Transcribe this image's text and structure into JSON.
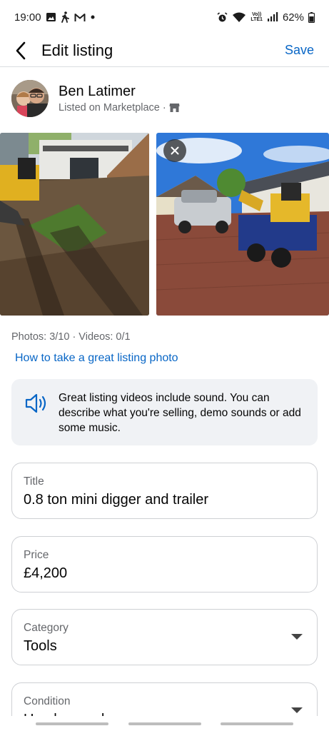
{
  "status_bar": {
    "time": "19:00",
    "notification_icons": [
      "image-icon",
      "walking-icon",
      "gmail-icon",
      "dot-icon"
    ],
    "network_label_top": "Vo))",
    "network_label_bottom": "LTE1",
    "battery": "62%"
  },
  "header": {
    "title": "Edit listing",
    "save_label": "Save"
  },
  "seller": {
    "name": "Ben Latimer",
    "subtitle": "Listed on Marketplace ·"
  },
  "photos": {
    "counts": "Photos: 3/10 · Videos: 0/1",
    "tips_link": "How to take a great listing photo"
  },
  "info_box": {
    "text": "Great listing videos include sound. You can describe what you're selling, demo sounds or add some music."
  },
  "fields": {
    "title": {
      "label": "Title",
      "value": "0.8 ton mini digger and trailer"
    },
    "price": {
      "label": "Price",
      "value": "£4,200"
    },
    "category": {
      "label": "Category",
      "value": "Tools"
    },
    "condition": {
      "label": "Condition",
      "value": "Used – good"
    }
  },
  "colors": {
    "accent": "#0866c6",
    "secondary_text": "#65676b",
    "info_bg": "#f0f2f5",
    "border": "#ced0d4"
  }
}
